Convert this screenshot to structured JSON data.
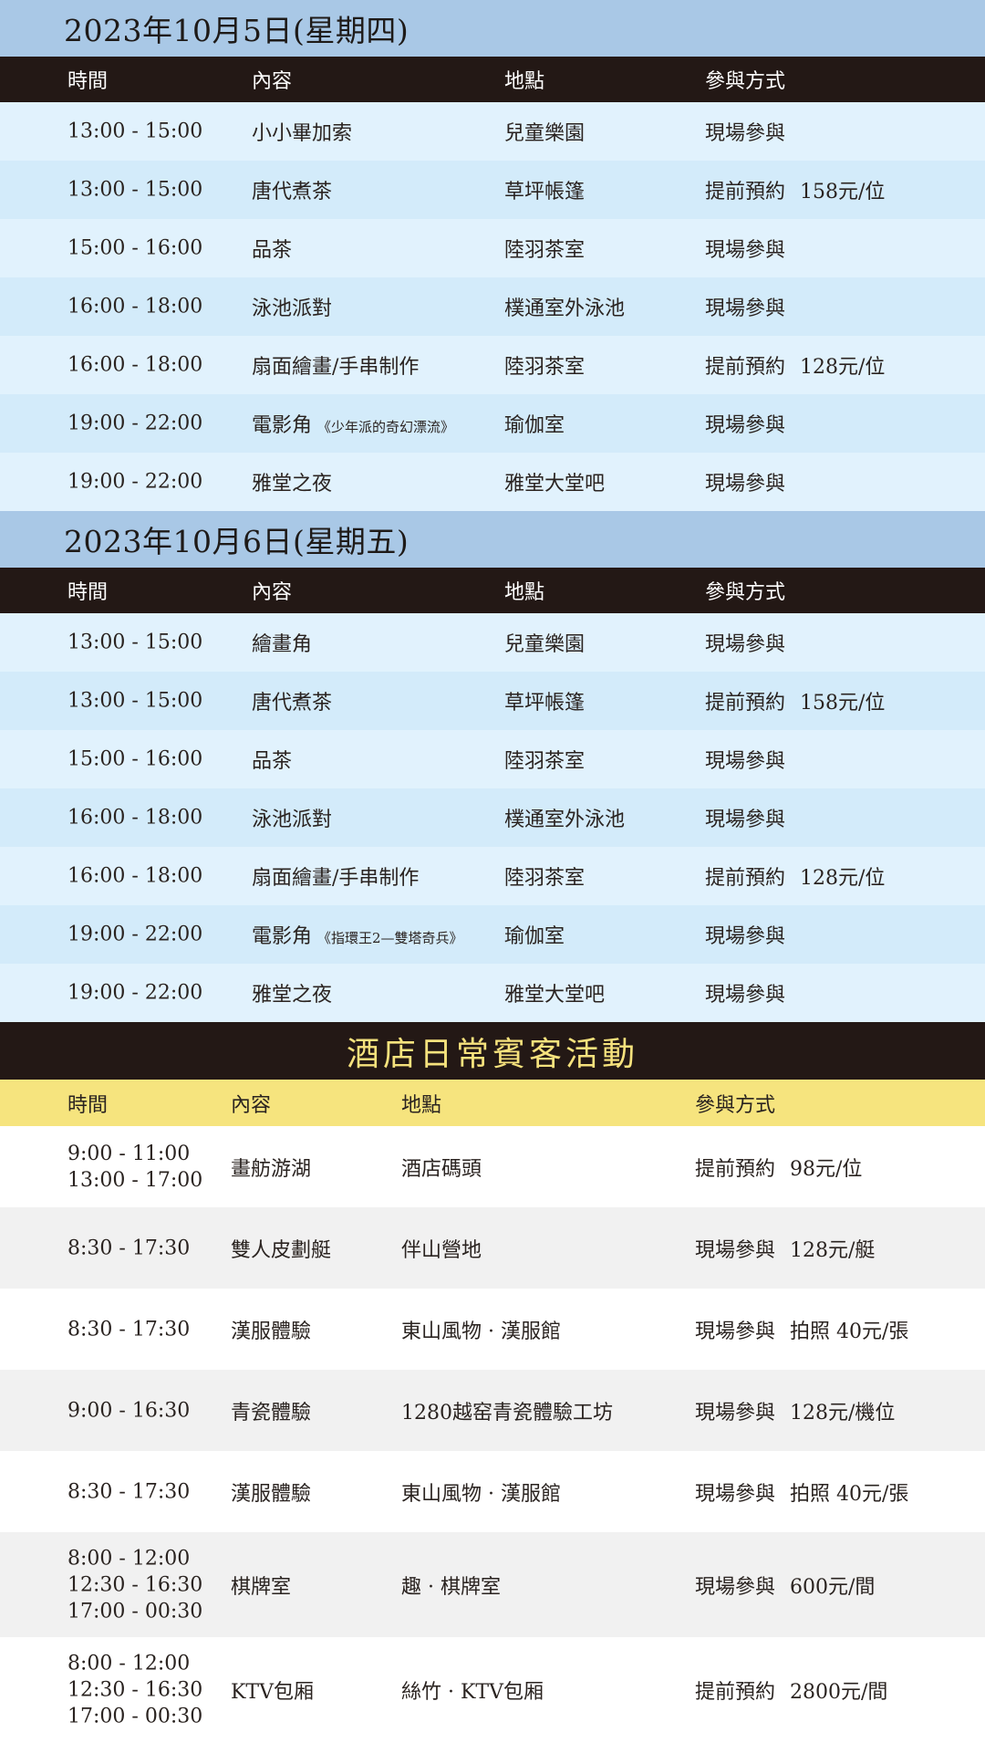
{
  "day1": {
    "date": "2023年10月5日(星期四)",
    "headers": {
      "time": "時間",
      "content": "內容",
      "place": "地點",
      "method": "參與方式"
    },
    "rows": [
      {
        "time": "13:00 - 15:00",
        "content": "小小畢加索",
        "film": "",
        "place": "兒童樂園",
        "method": "現場參與",
        "price": ""
      },
      {
        "time": "13:00 - 15:00",
        "content": "唐代煮茶",
        "film": "",
        "place": "草坪帳篷",
        "method": "提前預約",
        "price": "158元/位"
      },
      {
        "time": "15:00 - 16:00",
        "content": "品茶",
        "film": "",
        "place": "陸羽茶室",
        "method": "現場參與",
        "price": ""
      },
      {
        "time": "16:00 - 18:00",
        "content": "泳池派對",
        "film": "",
        "place": "樸通室外泳池",
        "method": "現場參與",
        "price": ""
      },
      {
        "time": "16:00 - 18:00",
        "content": "扇面繪畫/手串制作",
        "film": "",
        "place": "陸羽茶室",
        "method": "提前預約",
        "price": "128元/位"
      },
      {
        "time": "19:00 - 22:00",
        "content": "電影角",
        "film": "《少年派的奇幻漂流》",
        "place": "瑜伽室",
        "method": "現場參與",
        "price": ""
      },
      {
        "time": "19:00 - 22:00",
        "content": "雅堂之夜",
        "film": "",
        "place": "雅堂大堂吧",
        "method": "現場參與",
        "price": ""
      }
    ]
  },
  "day2": {
    "date": "2023年10月6日(星期五)",
    "headers": {
      "time": "時間",
      "content": "內容",
      "place": "地點",
      "method": "參與方式"
    },
    "rows": [
      {
        "time": "13:00 - 15:00",
        "content": "繪畫角",
        "film": "",
        "place": "兒童樂園",
        "method": "現場參與",
        "price": ""
      },
      {
        "time": "13:00 - 15:00",
        "content": "唐代煮茶",
        "film": "",
        "place": "草坪帳篷",
        "method": "提前預約",
        "price": "158元/位"
      },
      {
        "time": "15:00 - 16:00",
        "content": "品茶",
        "film": "",
        "place": "陸羽茶室",
        "method": "現場參與",
        "price": ""
      },
      {
        "time": "16:00 - 18:00",
        "content": "泳池派對",
        "film": "",
        "place": "樸通室外泳池",
        "method": "現場參與",
        "price": ""
      },
      {
        "time": "16:00 - 18:00",
        "content": "扇面繪畫/手串制作",
        "film": "",
        "place": "陸羽茶室",
        "method": "提前預約",
        "price": "128元/位"
      },
      {
        "time": "19:00 - 22:00",
        "content": "電影角",
        "film": "《指環王2—雙塔奇兵》",
        "place": "瑜伽室",
        "method": "現場參與",
        "price": ""
      },
      {
        "time": "19:00 - 22:00",
        "content": "雅堂之夜",
        "film": "",
        "place": "雅堂大堂吧",
        "method": "現場參與",
        "price": ""
      }
    ]
  },
  "daily": {
    "title": "酒店日常賓客活動",
    "headers": {
      "time": "時間",
      "content": "內容",
      "place": "地點",
      "method": "參與方式"
    },
    "rows": [
      {
        "times": [
          "9:00 - 11:00",
          "13:00 - 17:00",
          ""
        ],
        "content": "畫舫游湖",
        "place": "酒店碼頭",
        "method": "提前預約",
        "price": "98元/位"
      },
      {
        "times": [
          "8:30 - 17:30",
          "",
          ""
        ],
        "content": "雙人皮劃艇",
        "place": "伴山營地",
        "method": "現場參與",
        "price": "128元/艇"
      },
      {
        "times": [
          "8:30 - 17:30",
          "",
          ""
        ],
        "content": "漢服體驗",
        "place": "東山風物 · 漢服館",
        "method": "現場參與",
        "price": "拍照 40元/張"
      },
      {
        "times": [
          "9:00 - 16:30",
          "",
          ""
        ],
        "content": "青瓷體驗",
        "place": "1280越窑青瓷體驗工坊",
        "method": "現場參與",
        "price": "128元/機位"
      },
      {
        "times": [
          "8:30 - 17:30",
          "",
          ""
        ],
        "content": "漢服體驗",
        "place": "東山風物 · 漢服館",
        "method": "現場參與",
        "price": "拍照 40元/張"
      },
      {
        "times": [
          "8:00 - 12:00",
          "12:30 - 16:30",
          "17:00 - 00:30"
        ],
        "content": "棋牌室",
        "place": "趣 · 棋牌室",
        "method": "現場參與",
        "price": "600元/間"
      },
      {
        "times": [
          "8:00 - 12:00",
          "12:30 - 16:30",
          "17:00 - 00:30"
        ],
        "content": "KTV包厢",
        "place": "絲竹 · KTV包厢",
        "method": "提前預約",
        "price": "2800元/間"
      }
    ]
  }
}
